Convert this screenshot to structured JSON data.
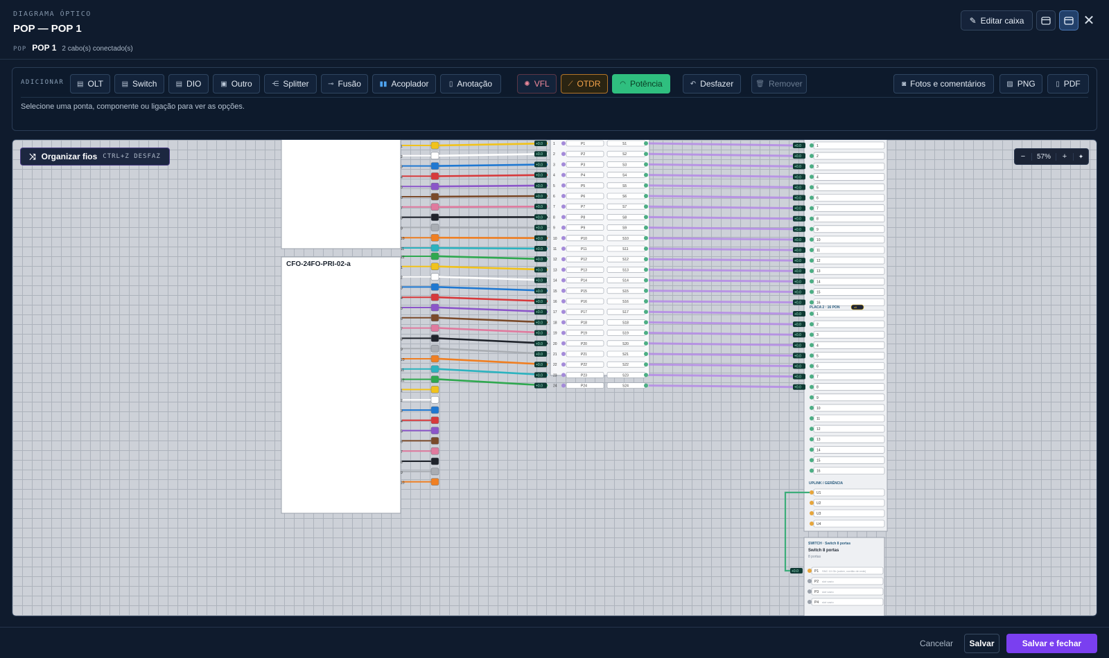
{
  "header": {
    "kicker": "DIAGRAMA ÓPTICO",
    "title": "POP — POP 1",
    "type_label": "POP",
    "name": "POP 1",
    "cables": "2 cabo(s) conectado(s)",
    "edit_label": "Editar caixa"
  },
  "toolbar": {
    "add_label": "ADICIONAR",
    "buttons": {
      "olt": "OLT",
      "switch": "Switch",
      "dio": "DIO",
      "outro": "Outro",
      "splitter": "Splitter",
      "fusao": "Fusão",
      "acoplador": "Acoplador",
      "anotacao": "Anotação",
      "vfl": "VFL",
      "otdr": "OTDR",
      "potencia": "Potência",
      "desfazer": "Desfazer",
      "remover": "Remover",
      "fotos": "Fotos e comentários",
      "png": "PNG",
      "pdf": "PDF"
    },
    "hint": "Selecione uma ponta, componente ou ligação para ver as opções."
  },
  "canvas": {
    "organize_label": "Organizar fios",
    "organize_shortcut": "CTRL+Z DESFAZ",
    "zoom": "57%",
    "cable_name": "CFO-24FO-PRI-02-a",
    "fiber_colors": [
      "#2fa84f",
      "#f1c21b",
      "#ffffff",
      "#1f78d1",
      "#d7393b",
      "#8b55c9",
      "#7a4a2a",
      "#e07a9e",
      "#1f232b",
      "#a9adb3",
      "#f07f22",
      "#2cb3bf"
    ],
    "dio_ports": [
      "P1",
      "P2",
      "P3",
      "P4",
      "P5",
      "P6",
      "P7",
      "P8",
      "P9",
      "P10",
      "P11",
      "P12",
      "P13",
      "P14",
      "P15",
      "P16",
      "P17",
      "P18",
      "P19",
      "P20",
      "P21",
      "P22",
      "P23",
      "P24"
    ],
    "splice_ports": [
      "S1",
      "S2",
      "S3",
      "S4",
      "S5",
      "S6",
      "S7",
      "S8",
      "S9",
      "S10",
      "S11",
      "S12",
      "S13",
      "S14",
      "S15",
      "S16",
      "S17",
      "S18",
      "S19",
      "S20",
      "S21",
      "S22",
      "S23",
      "S24"
    ],
    "fusion_label": "+0.0",
    "olt_plate2_title": "PLACA 2 · 16 PON",
    "olt_plate2_tag": "olt",
    "uplink_title": "UPLINK / GERÊNCIA",
    "uplink_ports": [
      "U1",
      "U2",
      "U3",
      "U4"
    ],
    "switch_kicker": "SWITCH · Switch 8 portas",
    "switch_name": "Switch 8 portas",
    "switch_ports_count": "8 portas",
    "switch_ports": [
      {
        "id": "P1",
        "desc": "SNC 10 Gb (cobre, cordão de rede)"
      },
      {
        "id": "P2",
        "desc": "slot vazio"
      },
      {
        "id": "P3",
        "desc": "slot vazio"
      },
      {
        "id": "P4",
        "desc": "slot vazio"
      }
    ]
  },
  "footer": {
    "cancel": "Cancelar",
    "save": "Salvar",
    "save_close": "Salvar e fechar"
  }
}
